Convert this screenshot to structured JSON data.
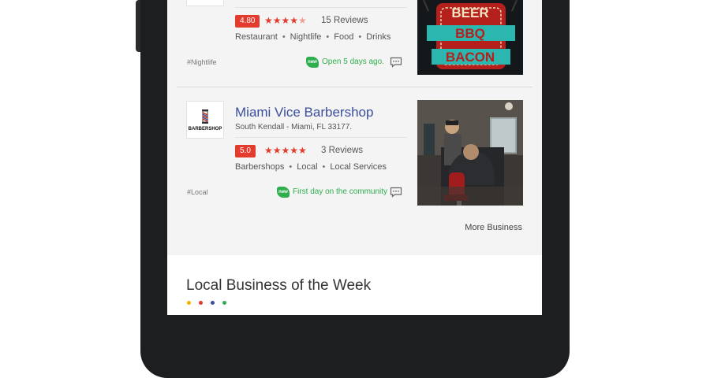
{
  "listings": [
    {
      "rating": "4.80",
      "stars": 4.5,
      "reviews": "15 Reviews",
      "categories": [
        "Restaurant",
        "Nightlife",
        "Food",
        "Drinks"
      ],
      "tag": "#Nightlife",
      "new_badge": "new",
      "status": "Open 5 days ago.",
      "thumb_text": [
        "BEER",
        "BBQ",
        "BACON"
      ]
    },
    {
      "name": "Miami Vice Barbershop",
      "address": "South Kendall - Miami, FL 33177.",
      "logo_text": "BARBERSHOP",
      "rating": "5.0",
      "stars": 5,
      "reviews": "3 Reviews",
      "categories": [
        "Barbershops",
        "Local",
        "Local Services"
      ],
      "tag": "#Local",
      "new_badge": "new",
      "status": "First day on the community"
    }
  ],
  "more_label": "More Business",
  "week_section": {
    "title": "Local Business of the Week",
    "dot_colors": [
      "#f2b400",
      "#e33b2e",
      "#3b4e9c",
      "#2fae4e"
    ]
  },
  "colors": {
    "accent_red": "#e33b2e",
    "link_blue": "#3b4e9c",
    "green": "#2fae4e"
  }
}
